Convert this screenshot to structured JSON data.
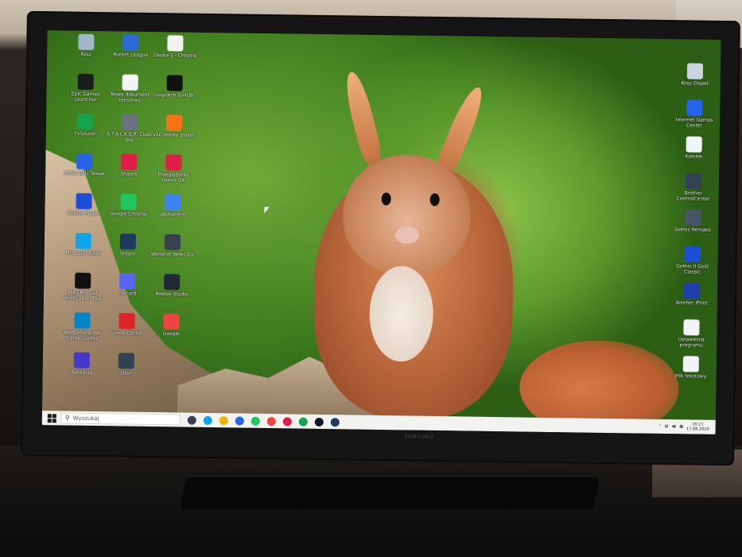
{
  "desktop": {
    "icons_left": [
      {
        "label": "Kosz",
        "icon": "recycle-bin-icon",
        "color": "#9fb7c9"
      },
      {
        "label": "Rocket League",
        "icon": "rocket-league-icon",
        "color": "#2c6bd6"
      },
      {
        "label": "Osoba 1 - Chrome",
        "icon": "file-icon",
        "color": "#f2f2f2"
      },
      {
        "label": "Epic Games Launcher",
        "icon": "epic-games-icon",
        "color": "#1c1c1c"
      },
      {
        "label": "Nowy dokument tekstowy",
        "icon": "text-file-icon",
        "color": "#f5f5f5"
      },
      {
        "label": "Logitech G HUB",
        "icon": "logitech-icon",
        "color": "#111111"
      },
      {
        "label": "FxSound",
        "icon": "sound-icon",
        "color": "#16a34a"
      },
      {
        "label": "S.T.A.L.K.E.R. Clear Sky",
        "icon": "stalker-icon",
        "color": "#6b7280"
      },
      {
        "label": "VLC media player",
        "icon": "vlc-icon",
        "color": "#f97316"
      },
      {
        "label": "ASUS GPU Tweak",
        "icon": "asus-icon",
        "color": "#2563eb"
      },
      {
        "label": "ShareX",
        "icon": "sharex-icon",
        "color": "#e11d48"
      },
      {
        "label": "Przeglądarka Opera GX",
        "icon": "opera-gx-icon",
        "color": "#e11d48"
      },
      {
        "label": "Roblox Player",
        "icon": "roblox-icon",
        "color": "#1d4ed8"
      },
      {
        "label": "Google Chrome",
        "icon": "chrome-icon",
        "color": "#22c55e"
      },
      {
        "label": "qBittorrent",
        "icon": "qbittorrent-icon",
        "color": "#3b82f6"
      },
      {
        "label": "Microsoft Edge",
        "icon": "edge-icon",
        "color": "#0ea5e9"
      },
      {
        "label": "Steam",
        "icon": "steam-icon",
        "color": "#1e3a5f"
      },
      {
        "label": "World of Tanks EU",
        "icon": "wot-icon",
        "color": "#374151"
      },
      {
        "label": "AMD Product Verification Tool",
        "icon": "amd-icon",
        "color": "#111111"
      },
      {
        "label": "Discord",
        "icon": "discord-icon",
        "color": "#5865f2"
      },
      {
        "label": "Roblox Studio",
        "icon": "roblox-studio-icon",
        "color": "#1f2937"
      },
      {
        "label": "Wargaming.net Game Center",
        "icon": "wargaming-icon",
        "color": "#0284c7"
      },
      {
        "label": "Game Center",
        "icon": "game-center-icon",
        "color": "#dc2626"
      },
      {
        "label": "Google",
        "icon": "maps-icon",
        "color": "#ef4444"
      },
      {
        "label": "Aplikacja",
        "icon": "app-icon",
        "color": "#4338ca"
      },
      {
        "label": "Osu!",
        "icon": "osu-icon",
        "color": "#334155"
      }
    ],
    "icons_right": [
      {
        "label": "Kosz Dispet",
        "icon": "recycle-bin-icon",
        "color": "#cbd5e1"
      },
      {
        "label": "Internet Games Center",
        "icon": "games-icon",
        "color": "#2563eb"
      },
      {
        "label": "Kafelek",
        "icon": "file-icon",
        "color": "#f1f5f9"
      },
      {
        "label": "Brother ControlCenter",
        "icon": "brother-icon",
        "color": "#334155"
      },
      {
        "label": "Gothic Remake",
        "icon": "gothic-icon",
        "color": "#475569"
      },
      {
        "label": "Gothic II Gold Classic",
        "icon": "gothic-2-icon",
        "color": "#1d4ed8"
      },
      {
        "label": "Brother iPrint",
        "icon": "iprint-icon",
        "color": "#1e40af"
      },
      {
        "label": "Ustawienia programu",
        "icon": "doc-icon",
        "color": "#f1f5f9"
      },
      {
        "label": "Plik tekstowy",
        "icon": "doc-icon",
        "color": "#f1f5f9"
      }
    ]
  },
  "taskbar": {
    "search_placeholder": "Wyszukaj",
    "apps": [
      {
        "icon": "task-view-icon",
        "color": "#374151"
      },
      {
        "icon": "edge-icon",
        "color": "#0ea5e9"
      },
      {
        "icon": "file-explorer-icon",
        "color": "#eab308"
      },
      {
        "icon": "mail-icon",
        "color": "#2563eb"
      },
      {
        "icon": "chrome-icon",
        "color": "#22c55e"
      },
      {
        "icon": "chrome-icon",
        "color": "#ef4444"
      },
      {
        "icon": "opera-gx-icon",
        "color": "#e11d48"
      },
      {
        "icon": "spotify-icon",
        "color": "#16a34a"
      },
      {
        "icon": "settings-icon",
        "color": "#111827"
      },
      {
        "icon": "steam-icon",
        "color": "#1e3a5f"
      }
    ],
    "time": "20:21",
    "date": "17.08.2020"
  },
  "monitor": {
    "brand": "SAMSUNG"
  }
}
